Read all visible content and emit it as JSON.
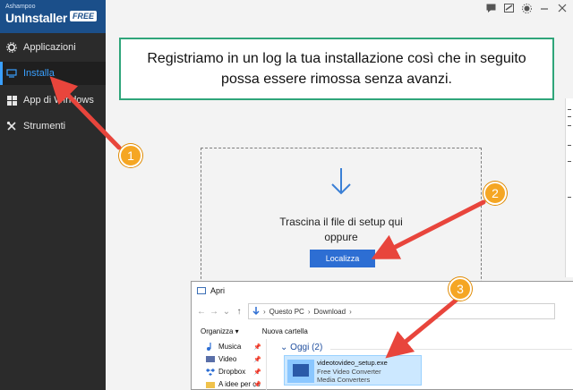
{
  "brand": {
    "small": "Ashampoo",
    "name": "UnInstaller",
    "edition": "FREE"
  },
  "sidebar": {
    "items": [
      {
        "label": "Applicazioni",
        "icon": "gear-icon"
      },
      {
        "label": "Installa",
        "icon": "monitor-icon",
        "active": true
      },
      {
        "label": "App di Windows",
        "icon": "windows-icon"
      },
      {
        "label": "Strumenti",
        "icon": "tools-icon"
      }
    ]
  },
  "topbar": {
    "icons": [
      "feedback-icon",
      "edit-icon",
      "settings-icon",
      "minimize-icon",
      "close-icon"
    ]
  },
  "notice": {
    "text": "Registriamo in un log la tua installazione così che in seguito possa essere rimossa senza avanzi."
  },
  "dropzone": {
    "line1": "Trascina il file di setup qui",
    "line2": "oppure",
    "button": "Localizza"
  },
  "dialog": {
    "title": "Apri",
    "breadcrumb": [
      "Questo PC",
      "Download"
    ],
    "organize": "Organizza ▾",
    "new_folder": "Nuova cartella",
    "nav_items": [
      {
        "label": "Musica",
        "icon": "music-icon"
      },
      {
        "label": "Video",
        "icon": "video-icon"
      },
      {
        "label": "Dropbox",
        "icon": "dropbox-icon"
      },
      {
        "label": "A idee per co",
        "icon": "folder-icon"
      }
    ],
    "group_label": "Oggi (2)",
    "file": {
      "name": "videotovideo_setup.exe",
      "line2": "Free Video Converter",
      "line3": "Media Converters"
    }
  },
  "annotations": {
    "badge1": "1",
    "badge2": "2",
    "badge3": "3"
  },
  "colors": {
    "accent": "#2d6ed3",
    "notice_border": "#2fa57a",
    "arrow": "#e8453c",
    "badge": "#f5a623"
  }
}
